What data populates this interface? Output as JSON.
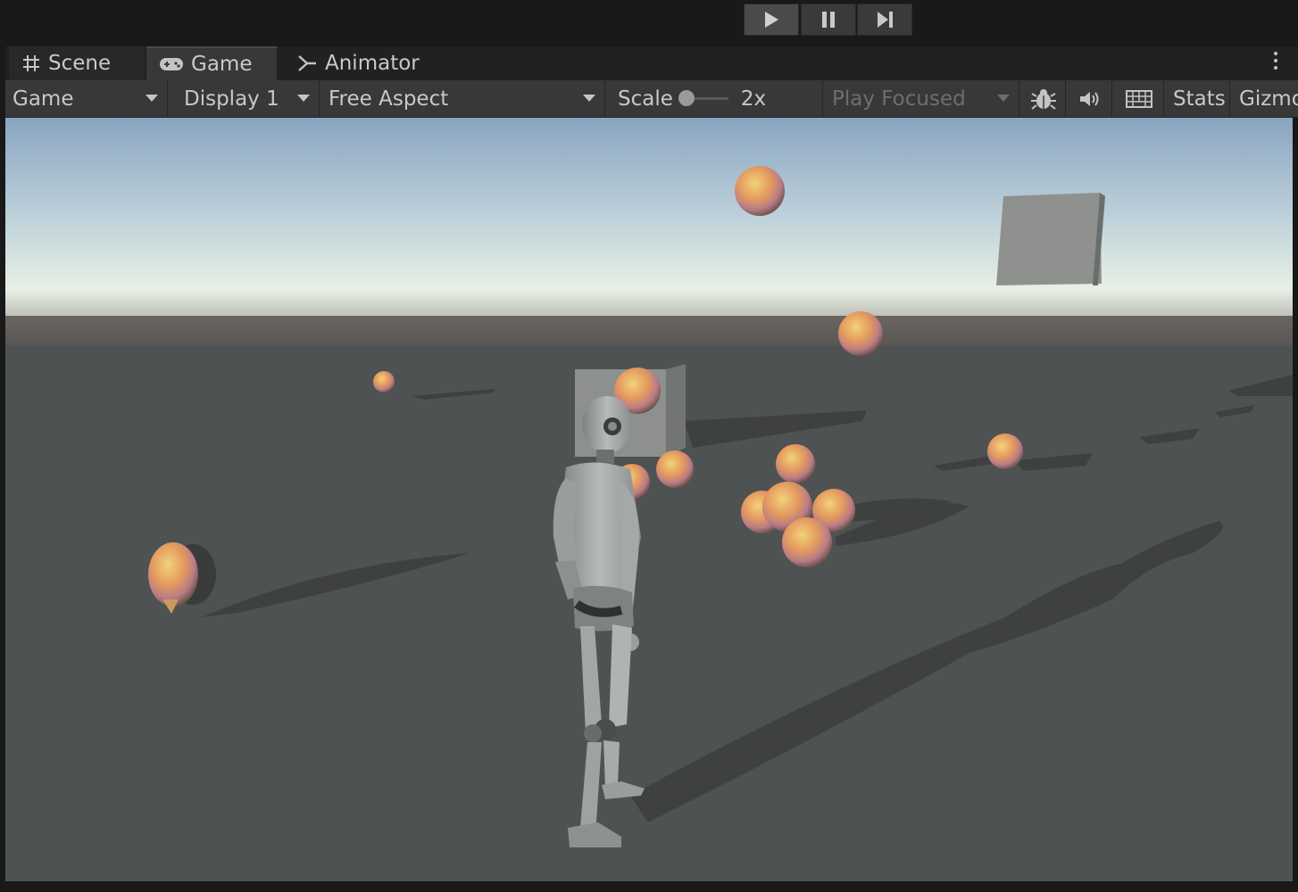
{
  "playbar": {
    "play_icon": "play-icon",
    "pause_icon": "pause-icon",
    "step_icon": "step-icon"
  },
  "tabs": [
    {
      "label": "Scene",
      "icon": "hash-grid-icon"
    },
    {
      "label": "Game",
      "icon": "gamepad-icon"
    },
    {
      "label": "Animator",
      "icon": "animator-icon"
    }
  ],
  "toolbar": {
    "game_select": "Game",
    "display_select": "Display 1",
    "aspect_select": "Free Aspect",
    "scale_label": "Scale",
    "scale_value": "2x",
    "play_focused": "Play Focused",
    "stats_label": "Stats",
    "gizmos_label": "Gizmos"
  },
  "colors": {
    "editor_bg": "#191919",
    "toolbar_bg": "#383838",
    "sky_top": "#8fa9c4",
    "sky_horizon": "#e6efe6",
    "ground": "#4f5252"
  }
}
